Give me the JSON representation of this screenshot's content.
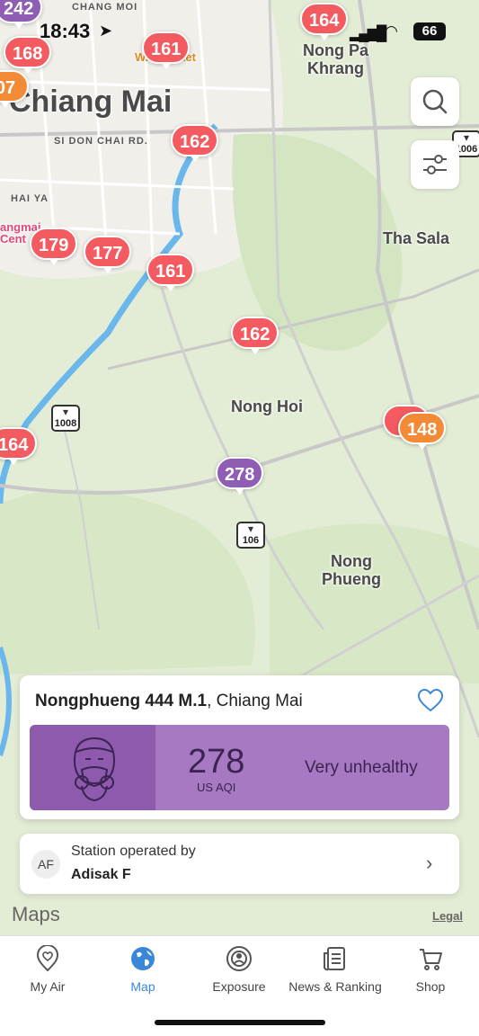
{
  "status_bar": {
    "time": "18:43",
    "battery": "66"
  },
  "map": {
    "place_labels": [
      {
        "text": "Chiang Mai",
        "cls": "big"
      },
      {
        "text": "Nong Pa\nKhrang"
      },
      {
        "text": "Tha Sala"
      },
      {
        "text": "Nong Hoi"
      },
      {
        "text": "Nong\nPhueng"
      },
      {
        "text": "HAI YA"
      },
      {
        "text": "CHANG MOI"
      },
      {
        "text": "SI DON CHAI RD."
      },
      {
        "text": "W... Market"
      },
      {
        "text": "angmai\nCent"
      }
    ],
    "road_shields": [
      "1008",
      "106",
      "1006"
    ],
    "pins": [
      {
        "value": "242",
        "color": "purple"
      },
      {
        "value": "168",
        "color": "red"
      },
      {
        "value": "161",
        "color": "red"
      },
      {
        "value": "164",
        "color": "red"
      },
      {
        "value": "07",
        "color": "orange"
      },
      {
        "value": "162",
        "color": "red"
      },
      {
        "value": "179",
        "color": "red"
      },
      {
        "value": "177",
        "color": "red"
      },
      {
        "value": "161",
        "color": "red"
      },
      {
        "value": "162",
        "color": "red"
      },
      {
        "value": "164",
        "color": "red"
      },
      {
        "value": "1",
        "color": "red"
      },
      {
        "value": "148",
        "color": "orange"
      },
      {
        "value": "278",
        "color": "purple"
      }
    ]
  },
  "controls": {
    "search_icon": "search-icon",
    "filter_icon": "filter-icon"
  },
  "card": {
    "station_name": "Nongphueng 444 M.1",
    "city": ", Chiang Mai",
    "aqi_value": "278",
    "aqi_unit": "US AQI",
    "aqi_level": "Very unhealthy",
    "colors": {
      "level_bg": "#a679c2",
      "face_bg": "#8e5aad"
    }
  },
  "station": {
    "initials": "AF",
    "label": "Station operated by",
    "operator": "Adisak F"
  },
  "attribution": {
    "maps": "Maps",
    "legal": "Legal"
  },
  "tabs": [
    {
      "label": "My Air",
      "icon": "location-heart-icon"
    },
    {
      "label": "Map",
      "icon": "globe-icon",
      "active": true
    },
    {
      "label": "Exposure",
      "icon": "exposure-icon"
    },
    {
      "label": "News & Ranking",
      "icon": "news-icon"
    },
    {
      "label": "Shop",
      "icon": "cart-icon"
    }
  ]
}
